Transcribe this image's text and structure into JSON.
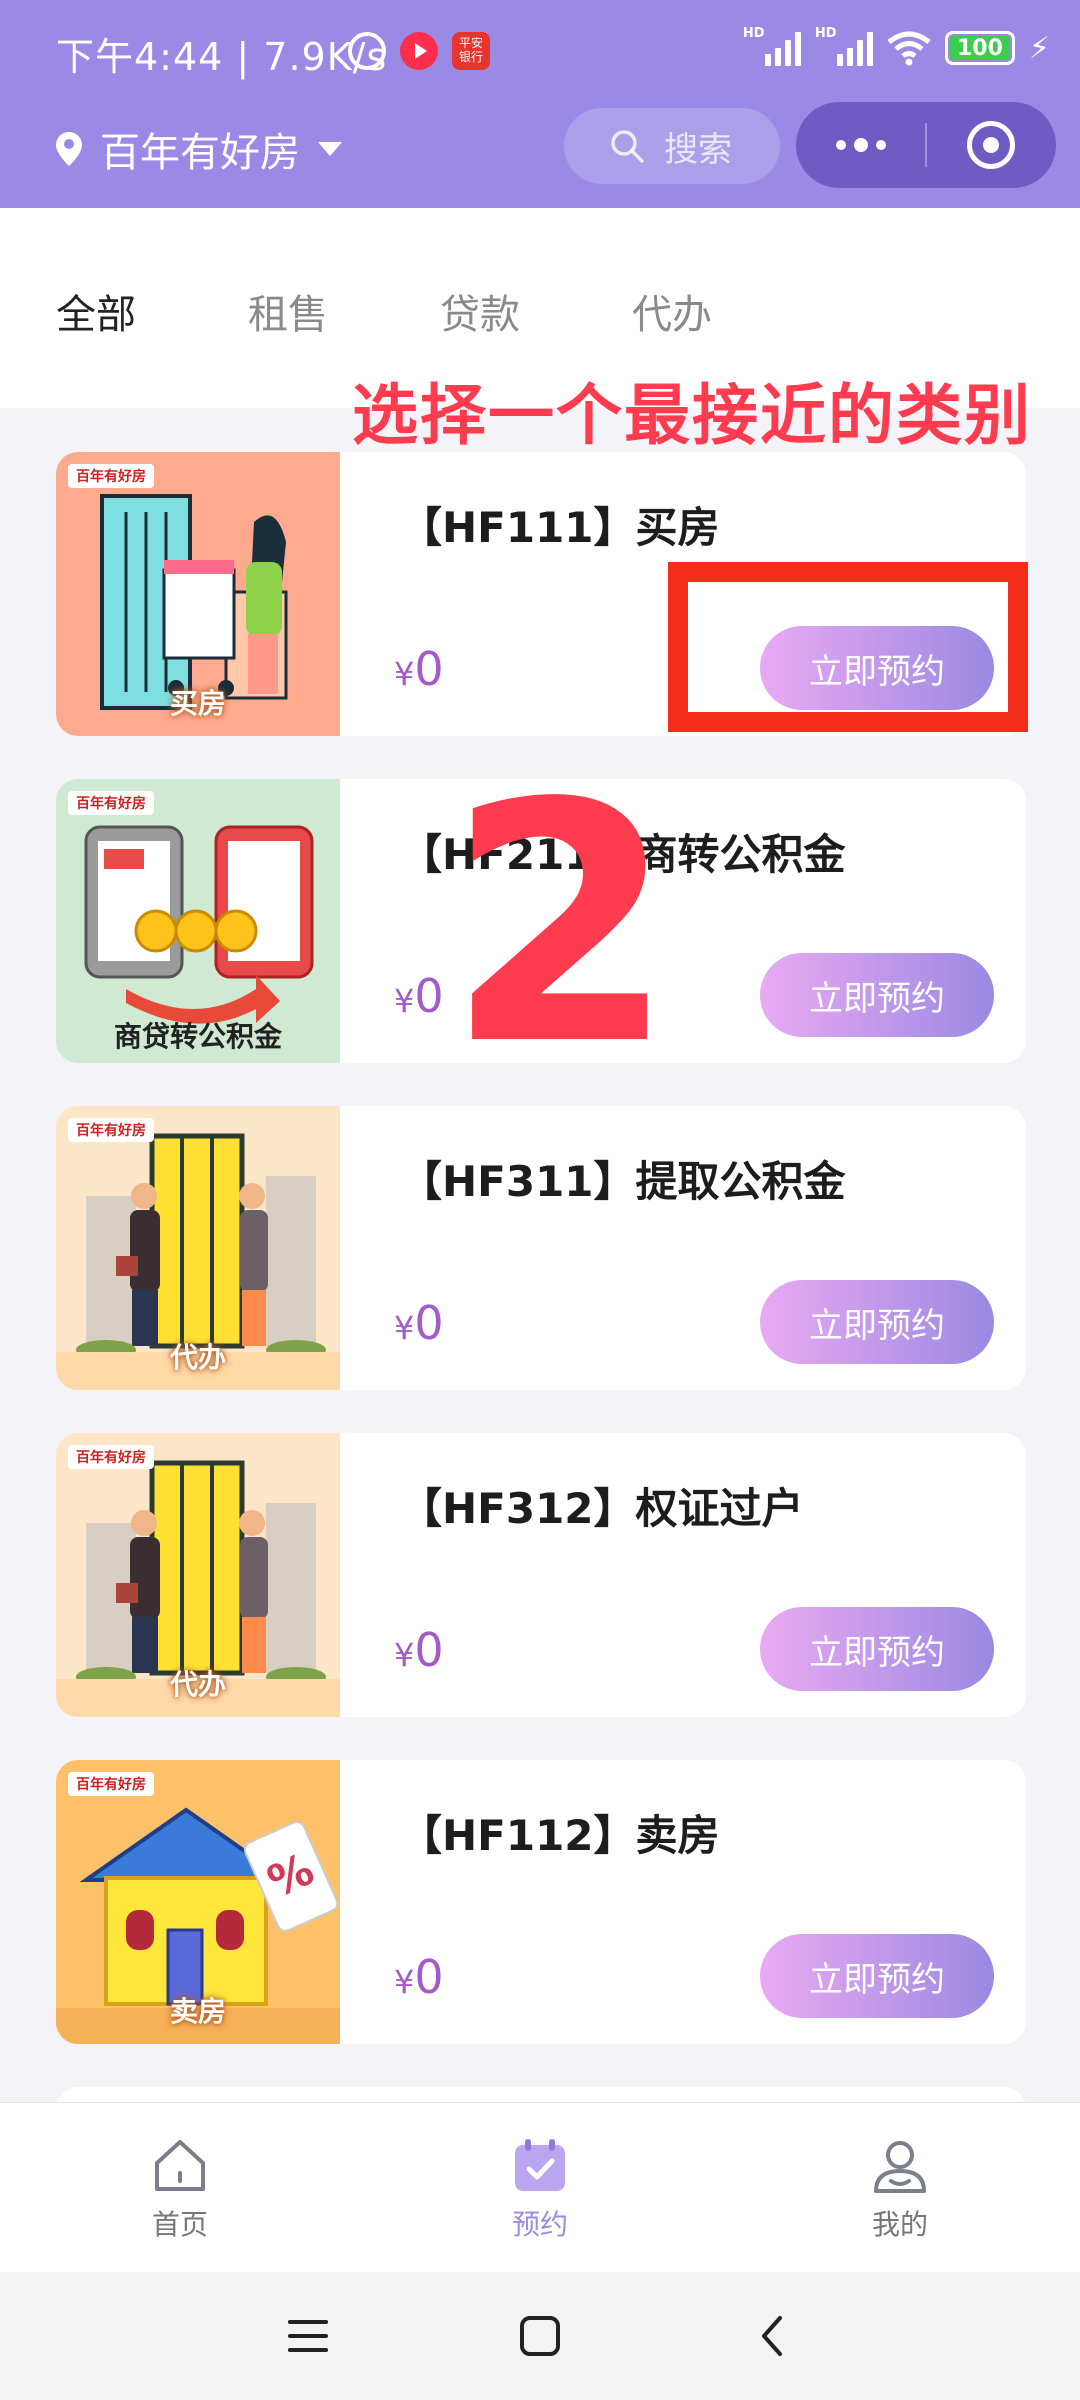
{
  "status_bar": {
    "time_speed": "下午4:44 | 7.9K/s",
    "icons": [
      "alarm-icon",
      "video-app-icon",
      "bank-app-icon"
    ],
    "signal_label": "HD",
    "battery": "100"
  },
  "header": {
    "location": "百年有好房",
    "search_placeholder": "搜索",
    "accent_color": "#9a8ae6"
  },
  "tabs": [
    {
      "label": "全部",
      "active": true
    },
    {
      "label": "租售",
      "active": false
    },
    {
      "label": "贷款",
      "active": false
    },
    {
      "label": "代办",
      "active": false
    }
  ],
  "annotation": {
    "text": "选择一个最接近的类别",
    "step": "2",
    "color": "#ff3b4f"
  },
  "services": [
    {
      "title": "【HF111】买房",
      "currency": "¥",
      "price": "0",
      "button": "立即预约",
      "image_label": "买房",
      "logo": "百年有好房"
    },
    {
      "title": "【HF211】商转公积金",
      "currency": "¥",
      "price": "0",
      "button": "立即预约",
      "image_label": "商贷转公积金",
      "logo": "百年有好房"
    },
    {
      "title": "【HF311】提取公积金",
      "currency": "¥",
      "price": "0",
      "button": "立即预约",
      "image_label": "代办",
      "logo": "百年有好房"
    },
    {
      "title": "【HF312】权证过户",
      "currency": "¥",
      "price": "0",
      "button": "立即预约",
      "image_label": "代办",
      "logo": "百年有好房"
    },
    {
      "title": "【HF112】卖房",
      "currency": "¥",
      "price": "0",
      "button": "立即预约",
      "image_label": "卖房",
      "logo": "百年有好房"
    }
  ],
  "bottom_nav": [
    {
      "label": "首页",
      "icon": "home-icon",
      "active": false
    },
    {
      "label": "预约",
      "icon": "calendar-icon",
      "active": true
    },
    {
      "label": "我的",
      "icon": "user-icon",
      "active": false
    }
  ],
  "system_nav": [
    "menu-icon",
    "home-square-icon",
    "back-icon"
  ]
}
